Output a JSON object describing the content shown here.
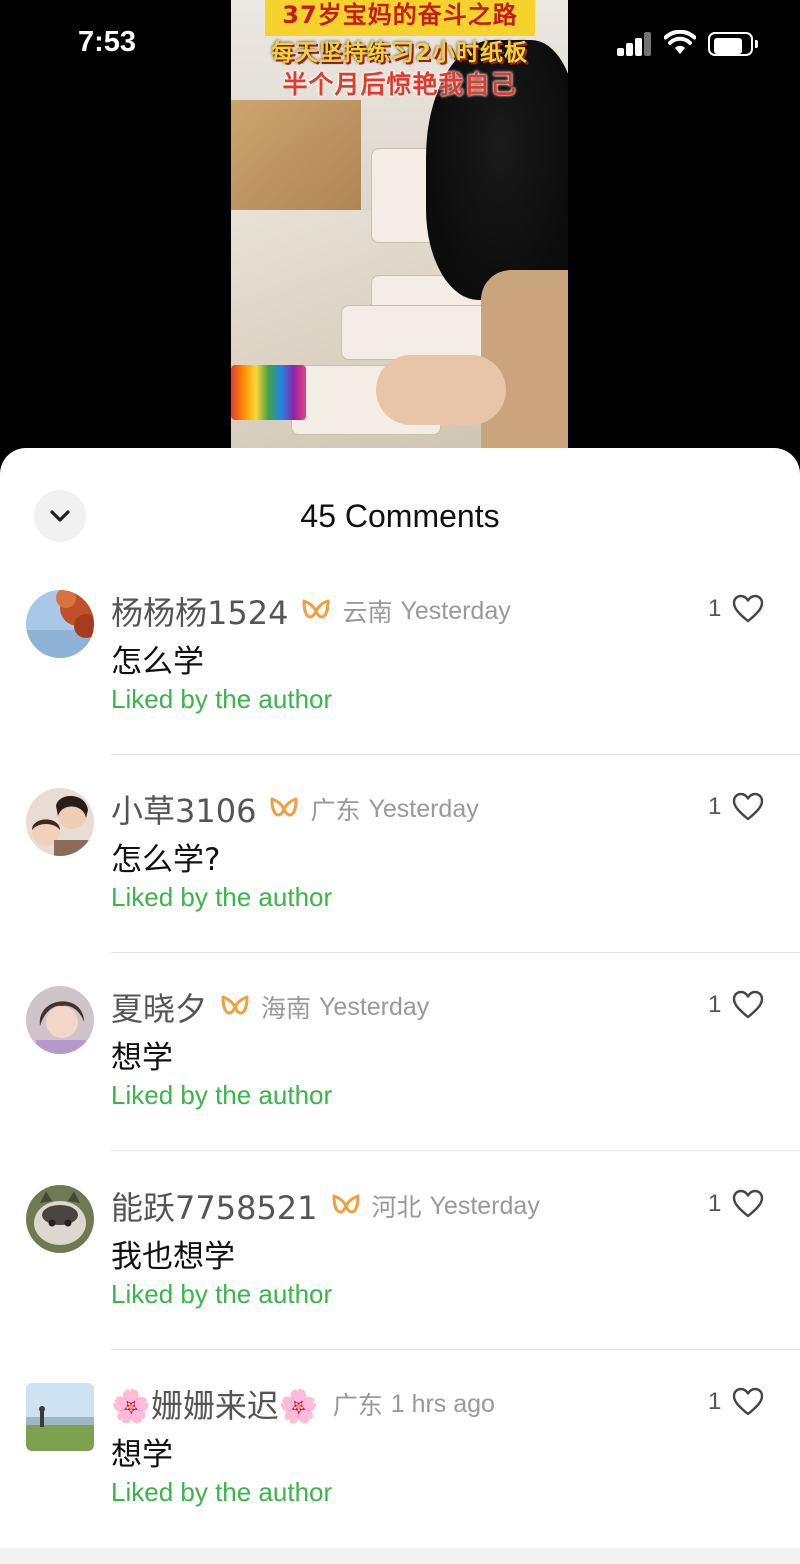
{
  "status_bar": {
    "time": "7:53",
    "battery_level": 0.75
  },
  "video": {
    "caption_line1": "37岁宝妈的奋斗之路",
    "caption_line2": "每天坚持练习2小时纸板",
    "caption_line3": "半个月后惊艳我自己"
  },
  "sheet": {
    "title": "45 Comments",
    "collapse_icon": "chevron-down-icon"
  },
  "comments": [
    {
      "username": "杨杨杨1524",
      "region": "云南",
      "time": "Yesterday",
      "text": "怎么学",
      "liked_label": "Liked by the author",
      "likes": "1"
    },
    {
      "username": "小草3106",
      "region": "广东",
      "time": "Yesterday",
      "text": "怎么学?",
      "liked_label": "Liked by the author",
      "likes": "1"
    },
    {
      "username": "夏晓夕",
      "region": "海南",
      "time": "Yesterday",
      "text": "想学",
      "liked_label": "Liked by the author",
      "likes": "1"
    },
    {
      "username": "能跃7758521",
      "region": "河北",
      "time": "Yesterday",
      "text": "我也想学",
      "liked_label": "Liked by the author",
      "likes": "1"
    },
    {
      "username": "🌸姗姗来迟🌸",
      "region": "广东",
      "time": "1 hrs ago",
      "text": "想学",
      "liked_label": "Liked by the author",
      "likes": "1"
    }
  ],
  "colors": {
    "liked": "#3ab54a",
    "vip_badge": "#f0a040",
    "muted": "#9a9a9a"
  }
}
